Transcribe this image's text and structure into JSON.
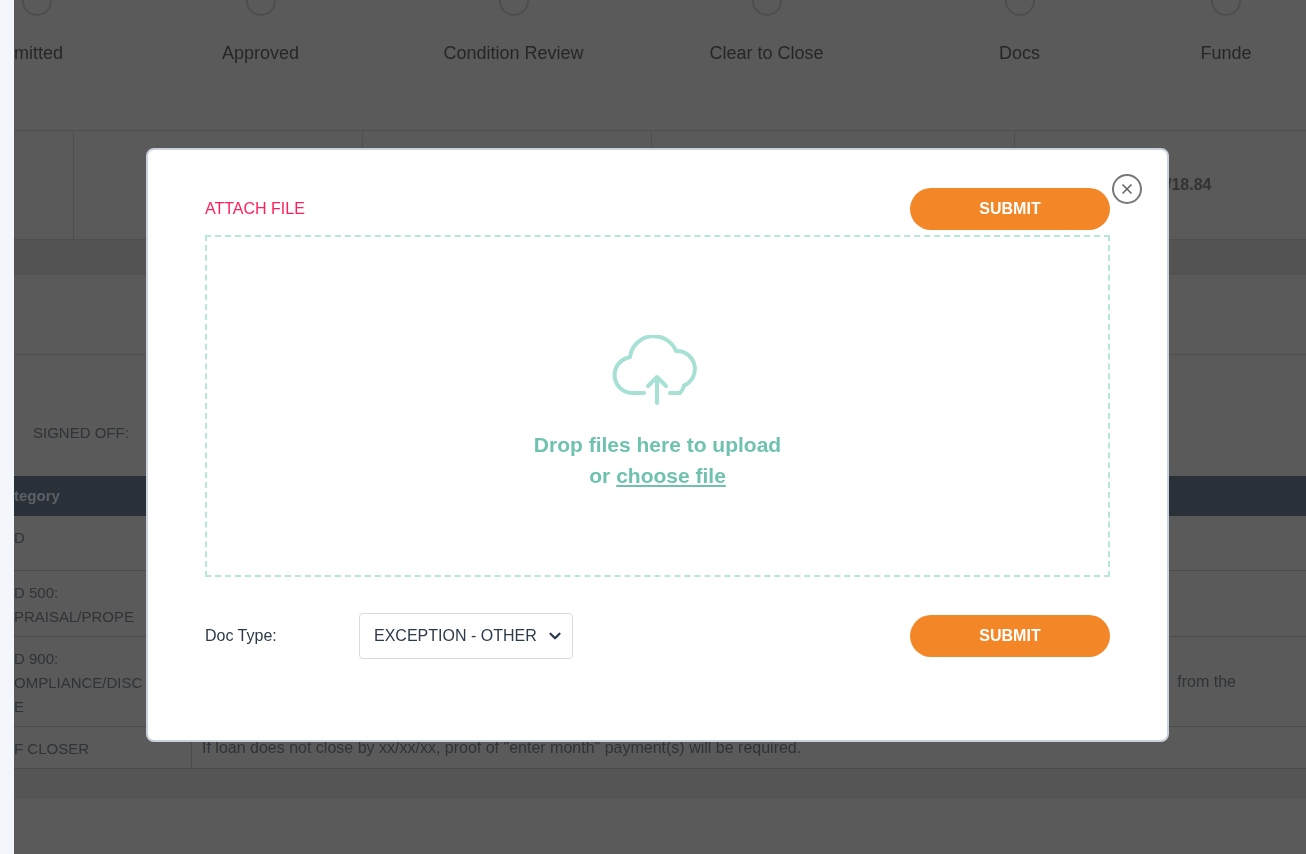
{
  "steps": [
    {
      "label": "mitted"
    },
    {
      "label": "Approved"
    },
    {
      "label": "Condition Review"
    },
    {
      "label": "Clear to Close"
    },
    {
      "label": "Docs"
    },
    {
      "label": "Funde"
    }
  ],
  "summary_row": {
    "value": "/18.84"
  },
  "signed_off": {
    "label": "SIGNED OFF:"
  },
  "conditions": {
    "columns": [
      "tegory"
    ],
    "rows": [
      {
        "category": "D",
        "description": ""
      },
      {
        "category": "D 500:\nPRAISAL/PROPE",
        "description": ""
      },
      {
        "category": "D 900:\nOMPLIANCE/DISC\nE",
        "description": "from the"
      },
      {
        "category": "F CLOSER",
        "description": "If loan does not close by xx/xx/xx, proof of \"enter month\" payment(s) will be required."
      }
    ]
  },
  "modal": {
    "title": "ATTACH FILE",
    "submit_top": "SUBMIT",
    "drop_text": "Drop files here to upload",
    "or_text": "or",
    "choose_link": "choose file",
    "doc_type_label": "Doc Type:",
    "doc_type_value": "EXCEPTION - OTHER",
    "submit_bottom": "SUBMIT"
  }
}
